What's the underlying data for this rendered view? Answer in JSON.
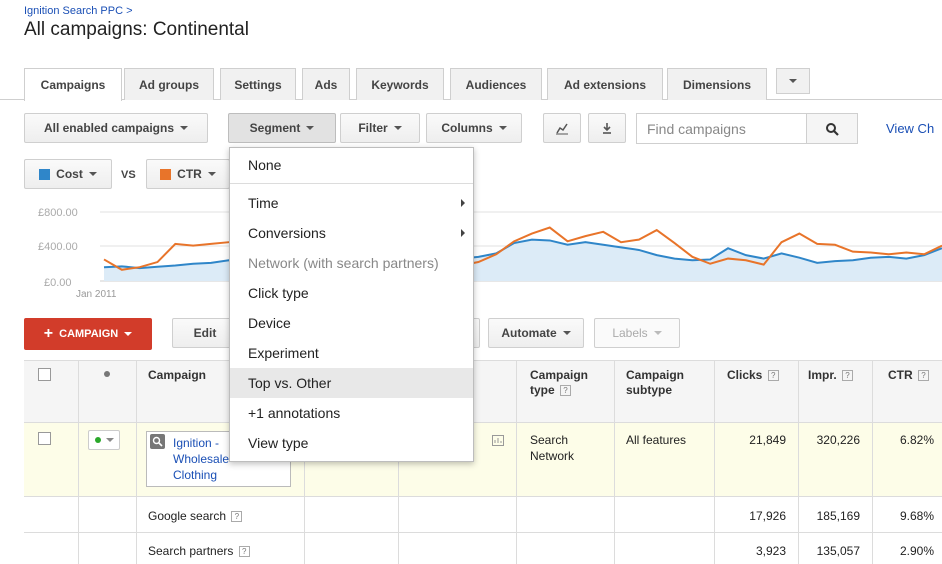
{
  "breadcrumb": "Ignition Search PPC >",
  "title": "All campaigns: Continental",
  "tabs": [
    "Campaigns",
    "Ad groups",
    "Settings",
    "Ads",
    "Keywords",
    "Audiences",
    "Ad extensions",
    "Dimensions"
  ],
  "toolbar": {
    "filter_scope": "All enabled campaigns",
    "segment": "Segment",
    "filter": "Filter",
    "columns": "Columns",
    "search_placeholder": "Find campaigns",
    "view_link": "View Ch"
  },
  "metrics": {
    "metric1": "Cost",
    "vs": "VS",
    "metric2": "CTR",
    "metric1_color": "#2f86c9",
    "metric2_color": "#e8742a"
  },
  "chart_data": {
    "type": "line",
    "y_ticks": [
      "£800.00",
      "£400.00",
      "£0.00"
    ],
    "x_label": "Jan 2011",
    "series": [
      {
        "name": "Cost",
        "color": "#2f86c9",
        "values": [
          160,
          170,
          150,
          165,
          180,
          200,
          210,
          240,
          230,
          220,
          210,
          220,
          200,
          215,
          205,
          210,
          200,
          215,
          225,
          250,
          260,
          280,
          320,
          440,
          480,
          470,
          420,
          450,
          420,
          390,
          360,
          300,
          260,
          240,
          250,
          380,
          300,
          260,
          320,
          270,
          210,
          230,
          240,
          270,
          280,
          260,
          300,
          380
        ]
      },
      {
        "name": "CTR",
        "color": "#e8742a",
        "values": [
          250,
          130,
          160,
          220,
          430,
          410,
          430,
          450,
          470,
          490,
          420,
          430,
          410,
          300,
          250,
          220,
          200,
          180,
          170,
          160,
          180,
          220,
          310,
          460,
          550,
          620,
          460,
          520,
          570,
          450,
          480,
          590,
          440,
          280,
          200,
          260,
          240,
          190,
          450,
          550,
          430,
          420,
          340,
          330,
          310,
          330,
          310,
          410
        ]
      }
    ]
  },
  "actions": {
    "new_campaign": "CAMPAIGN",
    "edit": "Edit",
    "automate": "Automate",
    "labels": "Labels"
  },
  "segment_menu": {
    "items": [
      {
        "label": "None",
        "submenu": false,
        "disabled": false,
        "highlight": false
      },
      {
        "label": "Time",
        "submenu": true,
        "disabled": false,
        "highlight": false
      },
      {
        "label": "Conversions",
        "submenu": true,
        "disabled": false,
        "highlight": false
      },
      {
        "label": "Network (with search partners)",
        "submenu": false,
        "disabled": true,
        "highlight": false
      },
      {
        "label": "Click type",
        "submenu": false,
        "disabled": false,
        "highlight": false
      },
      {
        "label": "Device",
        "submenu": false,
        "disabled": false,
        "highlight": false
      },
      {
        "label": "Experiment",
        "submenu": false,
        "disabled": false,
        "highlight": false
      },
      {
        "label": "Top vs. Other",
        "submenu": false,
        "disabled": false,
        "highlight": true
      },
      {
        "label": "+1 annotations",
        "submenu": false,
        "disabled": false,
        "highlight": false
      },
      {
        "label": "View type",
        "submenu": false,
        "disabled": false,
        "highlight": false
      }
    ]
  },
  "table": {
    "headers": {
      "campaign": "Campaign",
      "campaign_type": "Campaign type",
      "campaign_subtype": "Campaign subtype",
      "clicks": "Clicks",
      "impr": "Impr.",
      "ctr": "CTR"
    },
    "campaign_row": {
      "name": "Ignition - Wholesale Clothing",
      "type": "Search Network",
      "subtype": "All features",
      "clicks": "21,849",
      "impr": "320,226",
      "ctr": "6.82%"
    },
    "segment_rows": [
      {
        "label": "Google search",
        "clicks": "17,926",
        "impr": "185,169",
        "ctr": "9.68%"
      },
      {
        "label": "Search partners",
        "clicks": "3,923",
        "impr": "135,057",
        "ctr": "2.90%"
      }
    ]
  }
}
